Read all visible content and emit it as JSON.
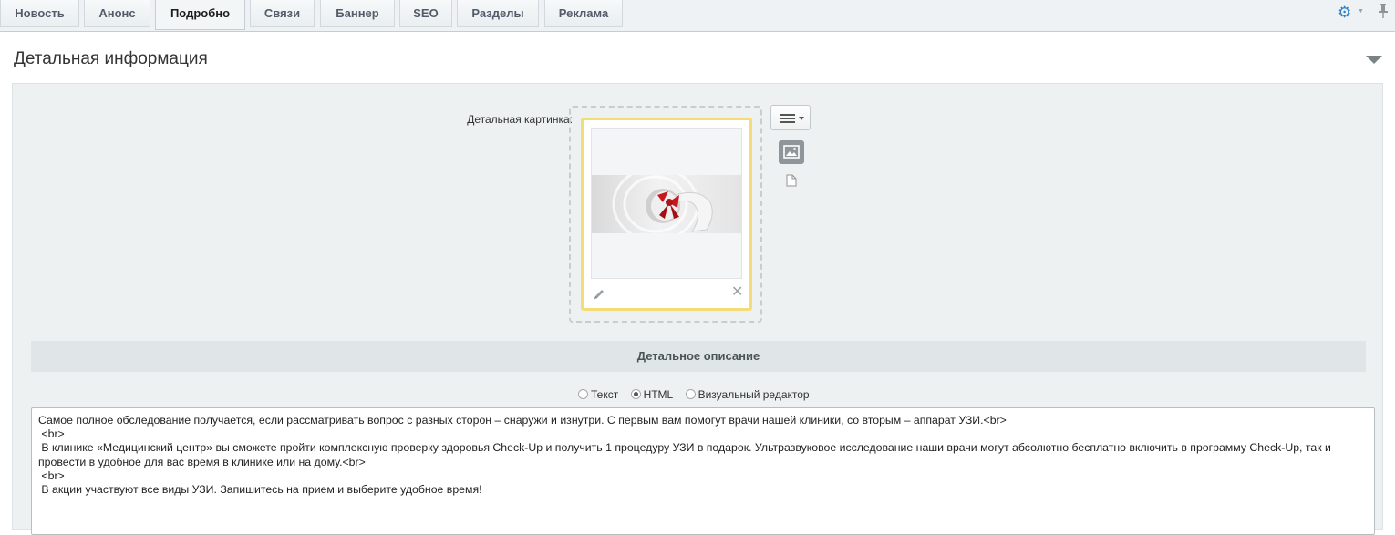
{
  "tabs": [
    {
      "label": "Новость",
      "active": false
    },
    {
      "label": "Анонс",
      "active": false
    },
    {
      "label": "Подробно",
      "active": true
    },
    {
      "label": "Связи",
      "active": false
    },
    {
      "label": "Баннер",
      "active": false
    },
    {
      "label": "SEO",
      "active": false
    },
    {
      "label": "Разделы",
      "active": false
    },
    {
      "label": "Реклама",
      "active": false
    }
  ],
  "toolbar": {
    "settings_icon": "gear-icon",
    "pin_icon": "pin-icon"
  },
  "section": {
    "title": "Детальная информация",
    "picture": {
      "label": "Детальная картинка:",
      "edit_icon": "pencil-icon",
      "remove_icon": "close-icon",
      "remove_glyph": "✕"
    },
    "description": {
      "header": "Детальное описание",
      "modes": [
        {
          "label": "Текст",
          "checked": false
        },
        {
          "label": "HTML",
          "checked": true
        },
        {
          "label": "Визуальный редактор",
          "checked": false
        }
      ],
      "content": "Самое полное обследование получается, если рассматривать вопрос с разных сторон – снаружи и изнутри. С первым вам помогут врачи нашей клиники, со вторым – аппарат УЗИ.<br>\n <br>\n В клинике «Медицинский центр» вы сможете пройти комплексную проверку здоровья Check-Up и получить 1 процедуру УЗИ в подарок. Ультразвуковое исследование наши врачи могут абсолютно бесплатно включить в программу Check-Up, так и провести в удобное для вас время в клинике или на дому.<br>\n <br>\n В акции участвуют все виды УЗИ. Запишитесь на прием и выберите удобное время!"
    }
  },
  "colors": {
    "accent": "#2f7fc8",
    "highlight_border": "#f6dc77",
    "panel_bg": "#edf1f2"
  }
}
